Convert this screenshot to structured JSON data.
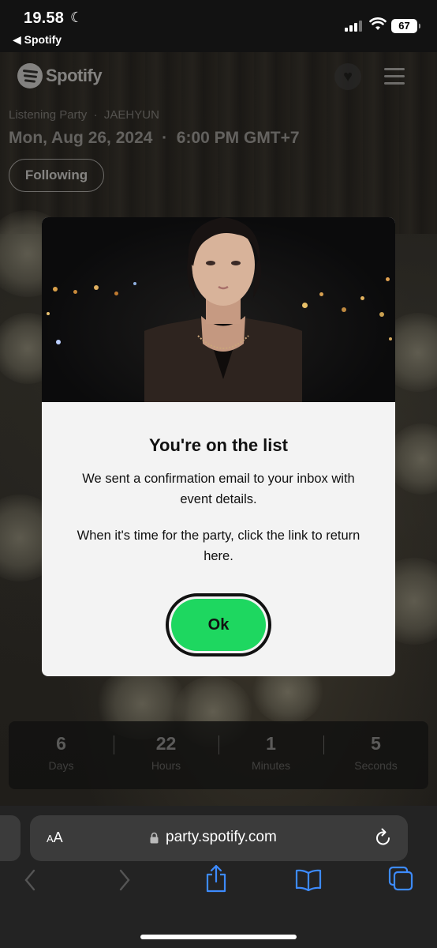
{
  "status_bar": {
    "time": "19.58",
    "back_app": "◀ Spotify",
    "battery": "67"
  },
  "header": {
    "brand": "Spotify"
  },
  "event": {
    "type": "Listening Party",
    "separator": "·",
    "artist": "JAEHYUN",
    "date": "Mon, Aug 26, 2024",
    "time": "6:00 PM GMT+7",
    "follow_label": "Following"
  },
  "modal": {
    "title": "You're on the list",
    "message": "We sent a confirmation email to your inbox with event details.",
    "message2": "When it's time for the party, click the link to return here.",
    "ok_label": "Ok"
  },
  "countdown": [
    {
      "value": "6",
      "label": "Days"
    },
    {
      "value": "22",
      "label": "Hours"
    },
    {
      "value": "1",
      "label": "Minutes"
    },
    {
      "value": "5",
      "label": "Seconds"
    }
  ],
  "browser": {
    "text_size_big": "A",
    "text_size_small": "A",
    "url": "party.spotify.com"
  },
  "colors": {
    "accent_green": "#1ed760",
    "ios_blue": "#3d8bff"
  }
}
